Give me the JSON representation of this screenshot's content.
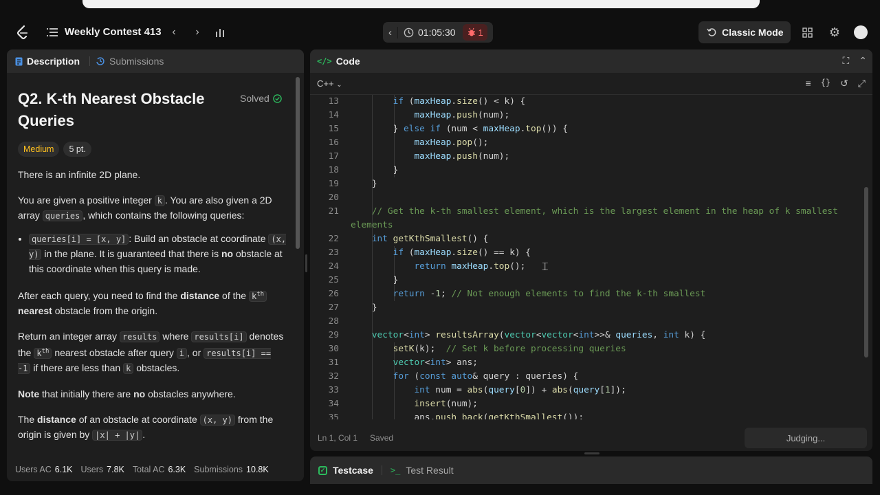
{
  "nav": {
    "contest_title": "Weekly Contest 413",
    "timer": "01:05:30",
    "bug_count": "1",
    "classic_mode_label": "Classic Mode"
  },
  "left": {
    "tabs": [
      {
        "label": "Description"
      },
      {
        "label": "Submissions"
      }
    ],
    "title": "Q2. K-th Nearest Obstacle Queries",
    "solved_label": "Solved",
    "difficulty": "Medium",
    "points": "5 pt.",
    "p1": "There is an infinite 2D plane.",
    "p2": {
      "a": "You are given a positive integer ",
      "k": "k",
      "b": ". You are also given a 2D array ",
      "queries": "queries",
      "c": ", which contains the following queries:"
    },
    "li": {
      "code1": "queries[i] = [x, y]",
      "a": ": Build an obstacle at coordinate ",
      "code2": "(x, y)",
      "b": " in the plane. It is guaranteed that there is ",
      "bold": "no",
      "c": " obstacle at this coordinate when this query is made."
    },
    "p3": {
      "a": "After each query, you need to find the ",
      "bold1": "distance",
      "b": " of the ",
      "kcode": "k",
      "sup": "th",
      "bold2": "nearest",
      "c": " obstacle from the origin."
    },
    "p4": {
      "a": "Return an integer array ",
      "code1": "results",
      "b": " where ",
      "code2": "results[i]",
      "c": " denotes the ",
      "kcode": "k",
      "sup": "th",
      "d": " nearest obstacle after query ",
      "code3": "i",
      "e": ", or ",
      "code4": "results[i] == -1",
      "f": " if there are less than ",
      "code5": "k",
      "g": " obstacles."
    },
    "p5": {
      "bold1": "Note",
      "a": " that initially there are ",
      "bold2": "no",
      "b": " obstacles anywhere."
    },
    "p6": {
      "a": "The ",
      "bold": "distance",
      "b": " of an obstacle at coordinate ",
      "code1": "(x, y)",
      "c": " from the origin is given by ",
      "code2": "|x| + |y|",
      "d": "."
    },
    "stats": [
      {
        "label": "Users AC",
        "value": "6.1K"
      },
      {
        "label": "Users",
        "value": "7.8K"
      },
      {
        "label": "Total AC",
        "value": "6.3K"
      },
      {
        "label": "Submissions",
        "value": "10.8K"
      }
    ]
  },
  "code": {
    "header_label": "Code",
    "language": "C++",
    "lines": [
      {
        "n": "13"
      },
      {
        "n": "14"
      },
      {
        "n": "15"
      },
      {
        "n": "16"
      },
      {
        "n": "17"
      },
      {
        "n": "18"
      },
      {
        "n": "19"
      },
      {
        "n": "20"
      },
      {
        "n": "21"
      },
      {
        "n": "22"
      },
      {
        "n": "23"
      },
      {
        "n": "24"
      },
      {
        "n": "25"
      },
      {
        "n": "26"
      },
      {
        "n": "27"
      },
      {
        "n": "28"
      },
      {
        "n": "29"
      },
      {
        "n": "30"
      },
      {
        "n": "31"
      },
      {
        "n": "32"
      },
      {
        "n": "33"
      },
      {
        "n": "34"
      },
      {
        "n": "35"
      }
    ],
    "status_position": "Ln 1, Col 1",
    "status_saved": "Saved",
    "judging_label": "Judging..."
  },
  "bottom": {
    "testcase_label": "Testcase",
    "test_result_label": "Test Result"
  },
  "colors": {
    "accent_green": "#2cbb5d",
    "medium": "#ffc01e",
    "bug_red": "#ff6b6b",
    "keyword": "#569cd6",
    "comment": "#6a9955"
  }
}
